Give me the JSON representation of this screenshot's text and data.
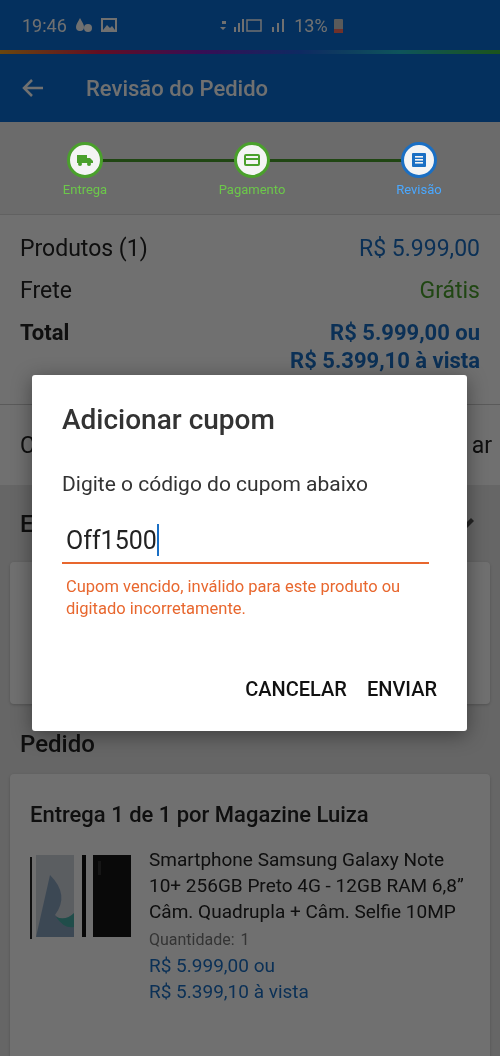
{
  "status_bar": {
    "time": "19:46",
    "battery": "13%"
  },
  "app_bar": {
    "title": "Revisão do Pedido"
  },
  "steps": [
    {
      "label": "Entrega",
      "kind": "truck",
      "selected": false
    },
    {
      "label": "Pagamento",
      "kind": "card",
      "selected": false
    },
    {
      "label": "Revisão",
      "kind": "list",
      "selected": true
    }
  ],
  "summary": [
    {
      "label": "Produtos (1)",
      "value": "R$ 5.999,00",
      "kind": "price"
    },
    {
      "label": "Frete",
      "value": "Grátis",
      "kind": "free"
    },
    {
      "label": "Total",
      "value": "R$ 5.999,00 ou",
      "value_2": "R$ 5.399,10 à vista",
      "kind": "total"
    }
  ],
  "coupon_row": {
    "label": "C",
    "action": "ar"
  },
  "address_section": {
    "heading": "E"
  },
  "order": {
    "heading": "Pedido",
    "delivery": "Entrega 1 de 1 por Magazine Luiza",
    "product": {
      "name": "Smartphone Samsung Galaxy Note 10+ 256GB Preto 4G - 12GB RAM 6,8” Câm. Quadrupla + Câm. Selfie 10MP",
      "quantity_label": "Quantidade:",
      "quantity": "1",
      "price": "R$ 5.999,00 ou",
      "price_cash": "R$ 5.399,10 à vista"
    }
  },
  "dialog": {
    "title": "Adicionar cupom",
    "message": "Digite o código do cupom abaixo",
    "field": {
      "value": "Off1500",
      "error": "Cupom vencido, inválido para este produto ou digitado incorretamente."
    },
    "buttons": [
      "CANCELAR",
      "ENVIAR"
    ]
  }
}
